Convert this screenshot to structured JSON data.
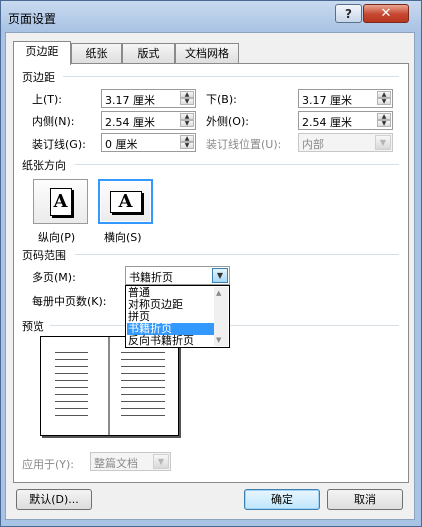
{
  "window": {
    "title": "页面设置",
    "help_symbol": "?",
    "close_symbol": "✕"
  },
  "tabs": [
    "页边距",
    "纸张",
    "版式",
    "文档网格"
  ],
  "margins": {
    "section": "页边距",
    "top": {
      "label": "上(T):",
      "value": "3.17 厘米"
    },
    "bottom": {
      "label": "下(B):",
      "value": "3.17 厘米"
    },
    "inside": {
      "label": "内侧(N):",
      "value": "2.54 厘米"
    },
    "outside": {
      "label": "外侧(O):",
      "value": "2.54 厘米"
    },
    "gutter": {
      "label": "装订线(G):",
      "value": "0 厘米"
    },
    "gutter_position": {
      "label": "装订线位置(U):",
      "value": "内部"
    }
  },
  "orientation": {
    "section": "纸张方向",
    "glyph": "A",
    "portrait_label": "纵向(P)",
    "landscape_label": "横向(S)",
    "selected": "landscape"
  },
  "pages": {
    "section": "页码范围",
    "multiple_label": "多页(M):",
    "multiple_value": "书籍折页",
    "per_booklet_label": "每册中页数(K):",
    "options": [
      "普通",
      "对称页边距",
      "拼页",
      "书籍折页",
      "反向书籍折页"
    ],
    "selected_option": "书籍折页"
  },
  "preview": {
    "section": "预览"
  },
  "apply": {
    "label": "应用于(Y):",
    "value": "整篇文档"
  },
  "buttons": {
    "default": "默认(D)...",
    "ok": "确定",
    "cancel": "取消"
  }
}
